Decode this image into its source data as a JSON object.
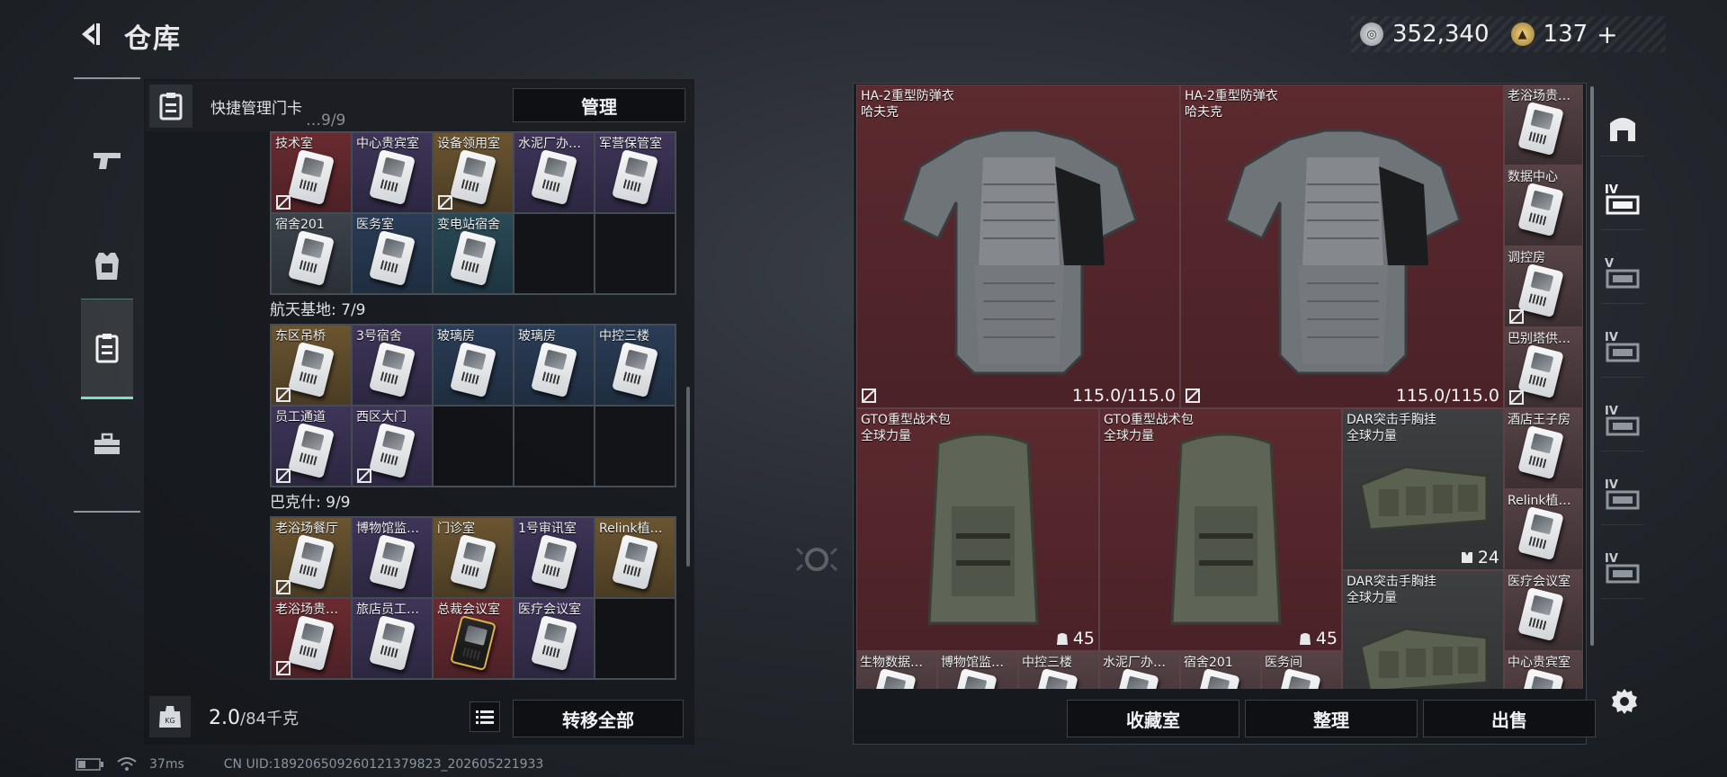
{
  "header": {
    "title": "仓库",
    "currency_silver": "352,340",
    "currency_gold": "137",
    "add_label": "+"
  },
  "keycard_panel": {
    "label": "快捷管理门卡",
    "manage_label": "管理",
    "partial_header": "…9/9",
    "groups": [
      {
        "title": "",
        "cards": [
          {
            "name": "技术室",
            "bg": "red",
            "locked": true
          },
          {
            "name": "中心贵宾室",
            "bg": "purple",
            "locked": false
          },
          {
            "name": "设备领用室",
            "bg": "gold",
            "locked": true
          },
          {
            "name": "水泥厂办…",
            "bg": "purple",
            "locked": false
          },
          {
            "name": "军营保管室",
            "bg": "purple",
            "locked": false
          },
          {
            "name": "宿舍201",
            "bg": "gray",
            "locked": false
          },
          {
            "name": "医务室",
            "bg": "blue",
            "locked": false
          },
          {
            "name": "变电站宿舍",
            "bg": "teal",
            "locked": false
          }
        ]
      },
      {
        "title": "航天基地: 7/9",
        "cards": [
          {
            "name": "东区吊桥",
            "bg": "gold",
            "locked": true
          },
          {
            "name": "3号宿舍",
            "bg": "purple",
            "locked": false
          },
          {
            "name": "玻璃房",
            "bg": "blue",
            "locked": false
          },
          {
            "name": "玻璃房",
            "bg": "blue",
            "locked": false
          },
          {
            "name": "中控三楼",
            "bg": "blue",
            "locked": false
          },
          {
            "name": "员工通道",
            "bg": "purple",
            "locked": true
          },
          {
            "name": "西区大门",
            "bg": "purple",
            "locked": true
          }
        ]
      },
      {
        "title": "巴克什: 9/9",
        "cards": [
          {
            "name": "老浴场餐厅",
            "bg": "gold",
            "locked": true
          },
          {
            "name": "博物馆监…",
            "bg": "purple",
            "locked": false
          },
          {
            "name": "门诊室",
            "bg": "gold",
            "locked": false
          },
          {
            "name": "1号审讯室",
            "bg": "purple",
            "locked": false
          },
          {
            "name": "Relink植…",
            "bg": "gold",
            "locked": false
          },
          {
            "name": "老浴场贵…",
            "bg": "red",
            "locked": true
          },
          {
            "name": "旅店员工…",
            "bg": "purple",
            "locked": false
          },
          {
            "name": "总裁会议室",
            "bg": "red",
            "locked": false,
            "gold": true
          },
          {
            "name": "医疗会议室",
            "bg": "purple",
            "locked": false
          }
        ]
      }
    ],
    "weight": "2.0",
    "weight_max": "/84千克",
    "transfer_label": "转移全部"
  },
  "status_bar": {
    "ping": "37ms",
    "uid": "CN UID:18920650926012137982З_202605221933"
  },
  "stash": {
    "large_items": [
      {
        "name": "HA-2重型防弹衣",
        "brand": "哈夫克",
        "stat": "115.0/115.0",
        "type": "armor"
      },
      {
        "name": "HA-2重型防弹衣",
        "brand": "哈夫克",
        "stat": "115.0/115.0",
        "type": "armor"
      },
      {
        "name": "GTO重型战术包",
        "brand": "全球力量",
        "stat": "45",
        "type": "backpack"
      },
      {
        "name": "GTO重型战术包",
        "brand": "全球力量",
        "stat": "45",
        "type": "backpack"
      },
      {
        "name": "DAR突击手胸挂",
        "brand": "全球力量",
        "stat": "24",
        "type": "rig"
      },
      {
        "name": "DAR突击手胸挂",
        "brand": "全球力量",
        "stat": "",
        "type": "rig"
      }
    ],
    "side_cards": [
      {
        "name": "老浴场贵…"
      },
      {
        "name": "数据中心"
      },
      {
        "name": "调控房"
      },
      {
        "name": "巴别塔供…"
      },
      {
        "name": "酒店王子房"
      },
      {
        "name": "Relink植…"
      },
      {
        "name": "医疗会议室"
      },
      {
        "name": "中心贵宾室"
      }
    ],
    "bottom_cards": [
      {
        "name": "生物数据…"
      },
      {
        "name": "博物馆监…"
      },
      {
        "name": "中控三楼"
      },
      {
        "name": "水泥厂办…"
      },
      {
        "name": "宿舍201"
      },
      {
        "name": "医务间"
      }
    ],
    "buttons": {
      "collection": "收藏室",
      "sort": "整理",
      "sell": "出售"
    }
  },
  "container_tabs": [
    {
      "level": "",
      "icon": "lobby-icon"
    },
    {
      "level": "IV",
      "icon": "container-icon"
    },
    {
      "level": "V",
      "icon": "container-icon"
    },
    {
      "level": "IV",
      "icon": "container-icon"
    },
    {
      "level": "IV",
      "icon": "container-icon"
    },
    {
      "level": "IV",
      "icon": "container-icon"
    },
    {
      "level": "IV",
      "icon": "container-icon"
    }
  ],
  "colors": {
    "accent": "#7ce0c3",
    "item_red": "#5c2a2f",
    "panel": "#14171b"
  }
}
